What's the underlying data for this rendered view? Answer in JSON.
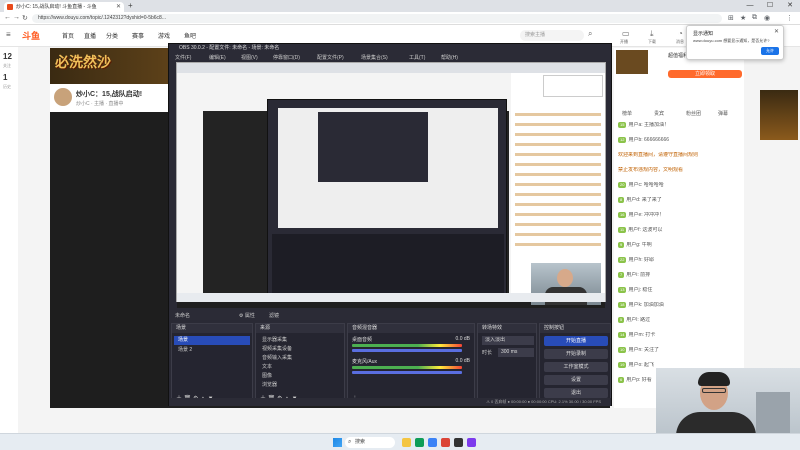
{
  "browser": {
    "tab_title": "炒小C: 15,战队启动! 斗鱼直播 - 斗鱼",
    "new_tab": "+",
    "url": "https://www.douyu.com/topic/.1242312?dyshid=0-5b6c8...",
    "win_min": "—",
    "win_max": "☐",
    "win_close": "✕"
  },
  "site": {
    "logo": "斗鱼",
    "nav": [
      "首页",
      "直播",
      "分类",
      "赛事",
      "游戏",
      "鱼吧"
    ],
    "search_placeholder": "搜索主播",
    "stats": [
      {
        "value": "12",
        "label": "关注"
      },
      {
        "value": "1",
        "label": "历史"
      }
    ],
    "header_icons": [
      {
        "icon": "tv-icon",
        "label": "开播"
      },
      {
        "icon": "download-icon",
        "label": "下载"
      },
      {
        "icon": "bell-icon",
        "label": "消息"
      }
    ]
  },
  "room": {
    "banner_text": "必洗然沙",
    "title": "炒小C：15,战队启动!",
    "subtitle": "炒小C · 主播 · 直播中"
  },
  "promo": {
    "title": "超值福利 点击领取",
    "button": "立即领取"
  },
  "chat": {
    "tabs": [
      "榜单",
      "贵宾",
      "粉丝团",
      "弹幕"
    ],
    "lines": [
      {
        "badge": "15",
        "text": "用户a: 主播加油！",
        "sys": false
      },
      {
        "badge": "12",
        "text": "用户b: 666666666",
        "sys": false
      },
      {
        "badge": "",
        "text": "欢迎来到直播间，请遵守直播间规则",
        "sys": true
      },
      {
        "badge": "",
        "text": "禁止发布违规内容，文明观看",
        "sys": true
      },
      {
        "badge": "20",
        "text": "用户c: 哈哈哈哈",
        "sys": false
      },
      {
        "badge": "8",
        "text": "用户d: 来了来了",
        "sys": false
      },
      {
        "badge": "16",
        "text": "用户e: 冲冲冲！",
        "sys": false
      },
      {
        "badge": "11",
        "text": "用户f: 这波可以",
        "sys": false
      },
      {
        "badge": "9",
        "text": "用户g: 牛啊",
        "sys": false
      },
      {
        "badge": "22",
        "text": "用户h: 好耶",
        "sys": false
      },
      {
        "badge": "7",
        "text": "用户i: 前排",
        "sys": false
      },
      {
        "badge": "13",
        "text": "用户j: 稳住",
        "sys": false
      },
      {
        "badge": "18",
        "text": "用户k: 加油加油",
        "sys": false
      },
      {
        "badge": "5",
        "text": "用户l: 路过",
        "sys": false
      },
      {
        "badge": "14",
        "text": "用户m: 打卡",
        "sys": false
      },
      {
        "badge": "10",
        "text": "用户n: 关注了",
        "sys": false
      },
      {
        "badge": "19",
        "text": "用户o: 起飞",
        "sys": false
      },
      {
        "badge": "6",
        "text": "用户p: 好看",
        "sys": false
      }
    ]
  },
  "popup": {
    "title": "显示通知",
    "body": "www.douyu.com 想要显示通知，是否允许?",
    "button": "允许",
    "close": "✕"
  },
  "obs": {
    "title": "OBS 30.0.2 - 配置文件: 未命名 - 场景: 未命名",
    "menu": [
      "文件(F)",
      "编辑(E)",
      "视图(V)",
      "停靠窗口(D)",
      "配置文件(P)",
      "场景集合(S)",
      "工具(T)",
      "帮助(H)"
    ],
    "scene_bar_left": "未命名",
    "scene_bar_mid": "⚙ 属性",
    "scene_bar_right": "滤镜",
    "docks": {
      "scenes": {
        "title": "场景",
        "items": [
          "场景",
          "场景 2"
        ]
      },
      "sources": {
        "title": "来源",
        "items": [
          "显示器采集",
          "视频采集设备",
          "音频输入采集",
          "文本",
          "图像",
          "浏览器"
        ]
      },
      "mixer": {
        "title": "音频混音器",
        "tracks": [
          {
            "name": "桌面音频",
            "db": "0.0 dB"
          },
          {
            "name": "麦克风/Aux",
            "db": "0.0 dB"
          }
        ]
      },
      "transitions": {
        "title": "转场特效",
        "type": "淡入淡出",
        "duration_label": "时长",
        "duration": "300 ms"
      },
      "controls": {
        "title": "控制按钮",
        "buttons": [
          "开始直播",
          "开始录制",
          "工作室模式",
          "设置",
          "退出"
        ]
      }
    },
    "status": "⚠ 0 丢弃帧  ● 00:00:00  ● 00:00:00  CPU: 2.1%  30.00 / 30.00 FPS"
  },
  "taskbar": {
    "search": "搜索",
    "apps": [
      {
        "icon": "explorer-icon",
        "color": "#f4c542"
      },
      {
        "icon": "edge-icon",
        "color": "#0f9d58"
      },
      {
        "icon": "store-icon",
        "color": "#3b82f6"
      },
      {
        "icon": "chrome-icon",
        "color": "#db4437"
      },
      {
        "icon": "obs-icon",
        "color": "#333333"
      },
      {
        "icon": "app-icon",
        "color": "#7c3aed"
      }
    ]
  }
}
